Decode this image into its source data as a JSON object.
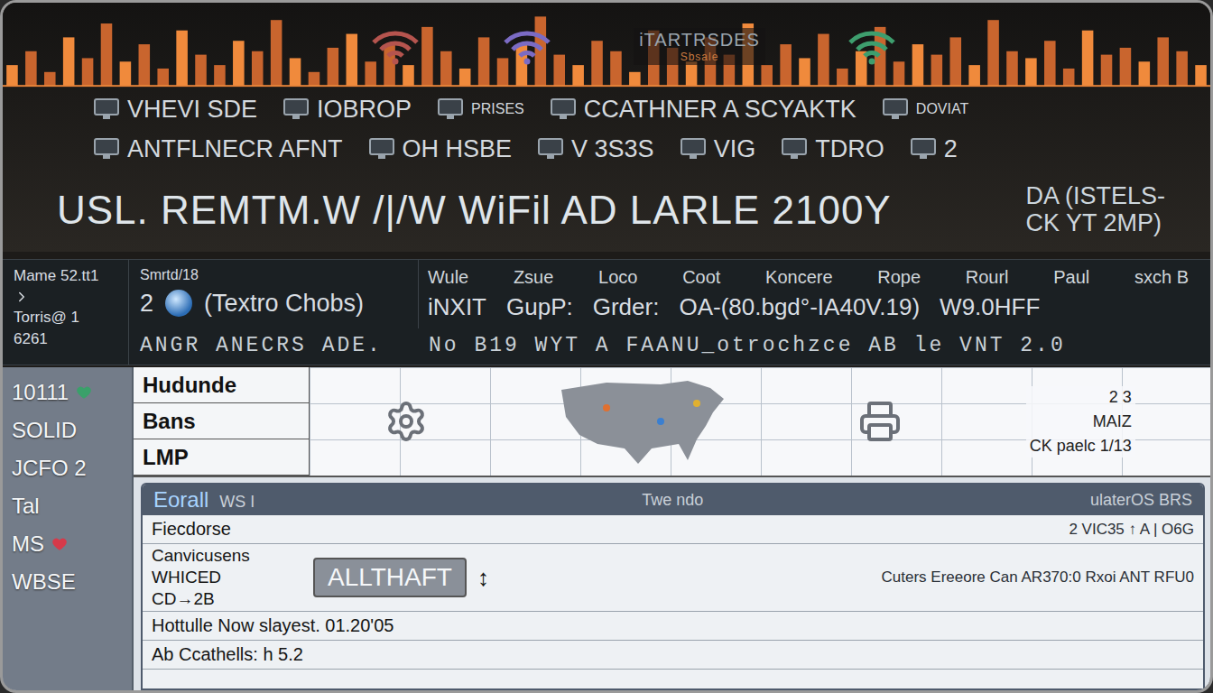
{
  "header": {
    "title": "iTARTRSDES",
    "subtitle": "Sbsale",
    "waveform": [
      0.3,
      0.5,
      0.2,
      0.7,
      0.4,
      0.9,
      0.35,
      0.6,
      0.25,
      0.8,
      0.45,
      0.3,
      0.65,
      0.5,
      0.95,
      0.4,
      0.2,
      0.55,
      0.75,
      0.35,
      0.6,
      0.3,
      0.85,
      0.5,
      0.25,
      0.7,
      0.4,
      0.6,
      1.0,
      0.45,
      0.3,
      0.65,
      0.5,
      0.2,
      0.8,
      0.55,
      0.35,
      0.7,
      0.45,
      0.9,
      0.3,
      0.6,
      0.4,
      0.75,
      0.25,
      0.5,
      0.85,
      0.35,
      0.6,
      0.45,
      0.7,
      0.3,
      0.95,
      0.5,
      0.4,
      0.65,
      0.25,
      0.8,
      0.45,
      0.55,
      0.35,
      0.7,
      0.5,
      0.3
    ],
    "wifi": [
      {
        "color": "#b5544e"
      },
      {
        "color": "#7b6bc4"
      },
      {
        "color": "#3e9e6e"
      }
    ],
    "row1": [
      {
        "label": "VHEVI SDE",
        "kind": "label"
      },
      {
        "label": "IOBROP",
        "kind": "label"
      },
      {
        "label": "PRISES",
        "kind": "caption"
      },
      {
        "label": "CCATHNER A SCYAKTK",
        "kind": "label"
      },
      {
        "label": "DOVIAT",
        "kind": "caption"
      }
    ],
    "row2": [
      {
        "label": "ANTFLNECR AFNT",
        "kind": "label"
      },
      {
        "label": "OH HSBE",
        "kind": "label"
      },
      {
        "label": "V 3S3S",
        "kind": "label"
      },
      {
        "label": "VIG",
        "kind": "label"
      },
      {
        "label": "TDRO",
        "kind": "label"
      },
      {
        "label": "2",
        "kind": "label"
      }
    ],
    "big_title": "USL. REMTM.W /|/W WiFil AD LARLE 2100Y",
    "side_lines": [
      "DA (ISTELS-",
      "CK YT 2MP)"
    ]
  },
  "panel": {
    "left": [
      "Mame 52.tt1",
      "Torris@ 1",
      "6261"
    ],
    "mid_caption": "Smrtd/18",
    "mid_number": "2",
    "mid_label": "(Textro Chobs)",
    "mid_footer": "ANGR ANECRS ADE.",
    "columns": [
      "Wule",
      "Zsue",
      "Loco",
      "Coot",
      "Koncere",
      "Rope",
      "Rourl",
      "Paul",
      "sxch B"
    ],
    "values": [
      "iNXIT",
      "GupP:",
      "Grder:",
      "OA-(80.bgd°-IA40V.19)",
      "W9.0HFF"
    ],
    "status": "No B19 WYT A FAANU_otrochzce AB le VNT 2.0"
  },
  "sidebar": {
    "items": [
      {
        "label": "10111",
        "color": "#3aa06a"
      },
      {
        "label": "SOLID"
      },
      {
        "label": "JCFO 2"
      },
      {
        "label": "Tal"
      },
      {
        "label": "MS",
        "color": "#d63a4a"
      },
      {
        "label": "WBSE"
      }
    ]
  },
  "grid": {
    "rows": [
      "Hudunde",
      "Bans",
      "LMP"
    ],
    "marks": [
      "2 3",
      "MAIZ",
      "CK paelc 1/13"
    ]
  },
  "inner": {
    "title": "Eorall",
    "tag": "WS I",
    "center": "Twe ndo",
    "right": "ulaterOS BRS",
    "rows": [
      {
        "kind": "line",
        "label": "Fiecdorse",
        "extra": "2 VIC35 ↑ A | O6G"
      },
      {
        "kind": "group",
        "labels": [
          "Canvicusens",
          "WHICED",
          "CD→2B"
        ],
        "button": "ALLTHAFT",
        "arrow": "↕",
        "extra": "Cuters  Ereeore  Can  AR370:0 Rxoi  ANT RFU0"
      },
      {
        "kind": "line",
        "label": "Hottulle Now slayest. 01.20'05",
        "extra": ""
      },
      {
        "kind": "line",
        "label": "Ab Ccathells: h 5.2",
        "extra": ""
      }
    ]
  }
}
